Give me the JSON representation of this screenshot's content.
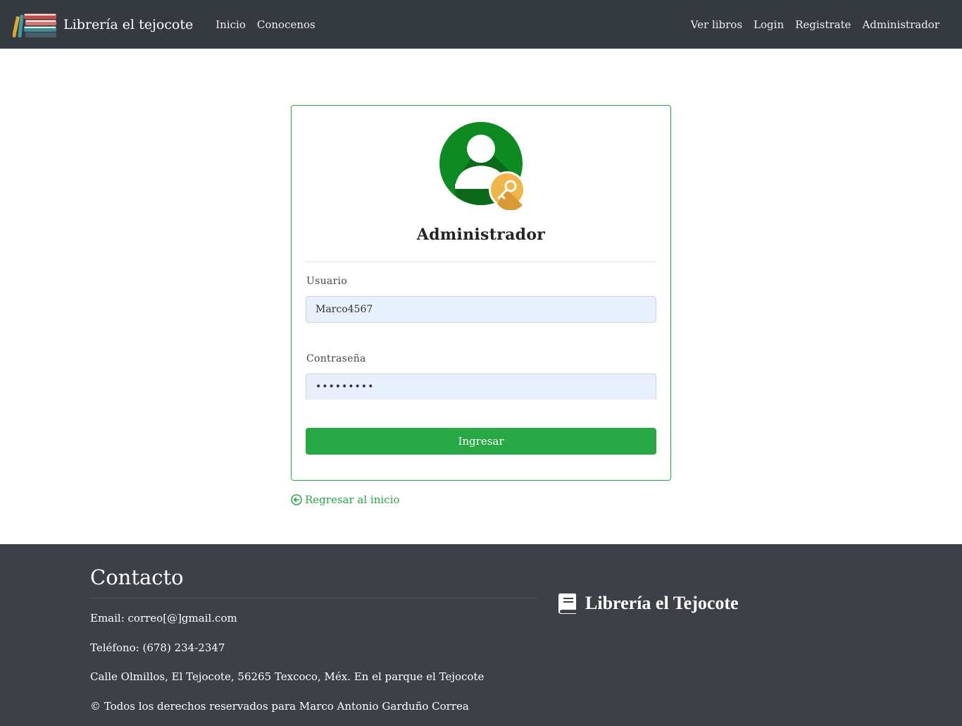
{
  "navbar": {
    "brand": "Librería el tejocote",
    "left_links": [
      "Inicio",
      "Conocenos"
    ],
    "right_links": [
      "Ver libros",
      "Login",
      "Registrate",
      "Administrador"
    ]
  },
  "login": {
    "title": "Administrador",
    "user_label": "Usuario",
    "user_value": "Marco4567",
    "password_label": "Contraseña",
    "password_value": "contra123",
    "submit_label": "Ingresar"
  },
  "back_link": "Regresar al inicio",
  "footer": {
    "title": "Contacto",
    "email": "Email: correo[@]gmail.com",
    "phone": "Teléfono: (678) 234-2347",
    "address": "Calle Olmillos, El Tejocote, 56265 Texcoco, Méx. En el parque el Tejocote",
    "copyright": "© Todos los derechos reservados para Marco Antonio Garduño Correa",
    "brand": "Librería el Tejocote"
  },
  "colors": {
    "navbar_bg": "#343a40",
    "accent_green": "#28a745",
    "input_bg": "#e8f0fe",
    "footer_bg": "#3d4046"
  }
}
